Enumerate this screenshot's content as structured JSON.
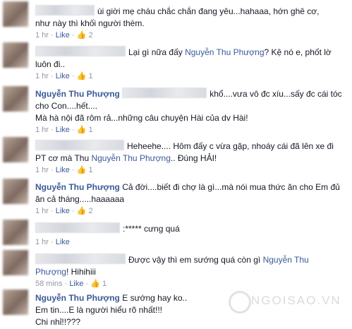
{
  "comments": [
    {
      "line1": "ùi giời mẹ cháu chắc chắn đang yêu...hahaaa, hớn ghê cơ,",
      "line2": "như này thì khối người thèm.",
      "time": "1 hr",
      "like": "Like",
      "count": "2"
    },
    {
      "line1a": "Lại gì nữa đấy ",
      "tag": "Nguyễn Thu Phượng",
      "line1b": "? Kệ nó e, phốt lờ",
      "line2": "luôn đi..",
      "time": "1 hr",
      "like": "Like",
      "count": "1"
    },
    {
      "name": "Nguyễn Thu Phượng",
      "line1": "khổ....vưa vô đc xíu...sấy đc cái tóc",
      "line2": "cho Con....hết....",
      "line3": "Mà hà nội đã rôm rả...những câu chuyện Hài của dv Hài!",
      "time": "1 hr",
      "like": "Like",
      "count": "1"
    },
    {
      "line1": "Heheehe.... Hôm đấy c vừa gặp, nhoáy cái đã lên xe đi",
      "line2a": "PT cơ mà Thu ",
      "tag": "Nguyễn Thu Phượng",
      "line2b": ".. Đúng HẢI!",
      "time": "1 hr",
      "like": "Like",
      "count": "1"
    },
    {
      "name": "Nguyễn Thu Phượng",
      "line1": " Cả đời....biết đi chợ là gì...mà nói mua thức ăn cho Em đủ",
      "line2": "ăn cả tháng.....haaaaaa",
      "time": "1 hr",
      "like": "Like",
      "count": "2"
    },
    {
      "line1": ":***** cưng quá",
      "time": "1 hr",
      "like": "Like"
    },
    {
      "line1a": "Được vậy thì em sướng quá còn gì ",
      "tag": "Nguyễn Thu",
      "tag2": "Phượng",
      "line2b": "! Hihihiii",
      "time": "58 mins",
      "like": "Like",
      "count": "1"
    },
    {
      "name": "Nguyễn Thu Phượng",
      "line1": " E sướng hay ko..",
      "line2": "Em tin....E là người hiểu rõ nhất!!!",
      "line3": "Chi nhỉ!!???"
    }
  ],
  "watermark": "NGOISAO.VN",
  "icons": {
    "thumb": "thumbs-up-icon"
  },
  "colors": {
    "link": "#3b5998",
    "meta": "#9197a3"
  }
}
